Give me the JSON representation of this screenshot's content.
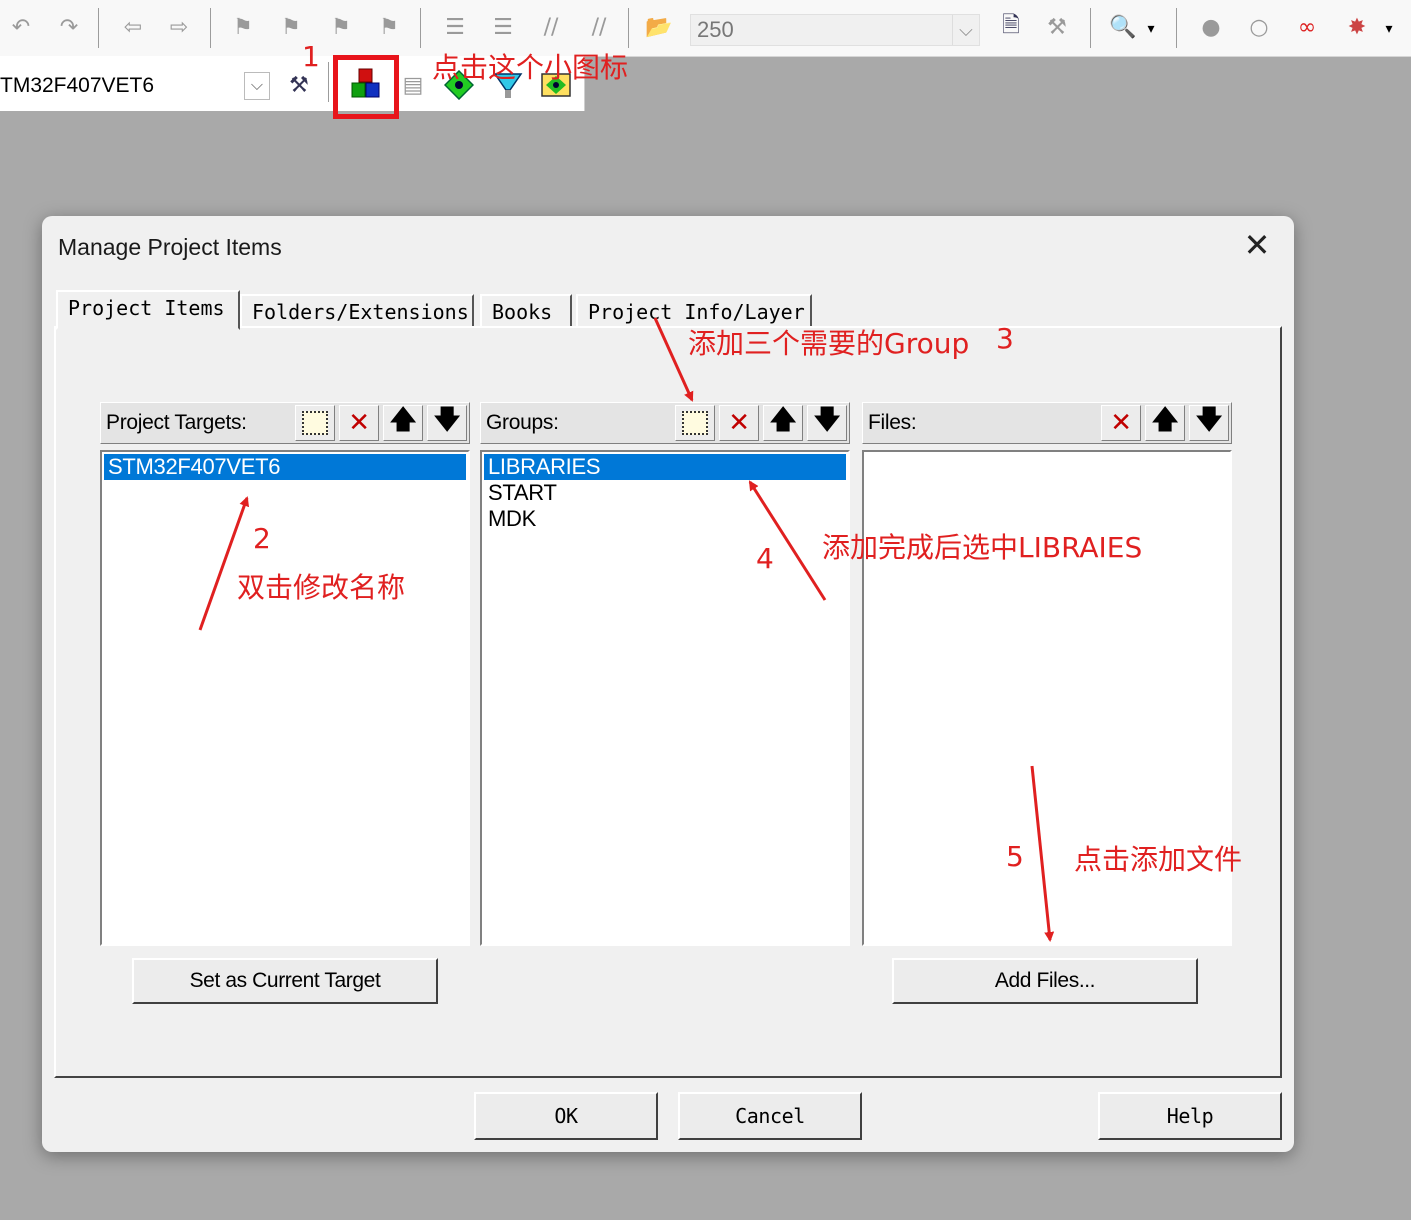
{
  "toolbar": {
    "zoom_value": "250",
    "target_name": "TM32F407VET6"
  },
  "dialog": {
    "title": "Manage Project Items",
    "close": "✕",
    "tabs": [
      "Project Items",
      "Folders/Extensions",
      "Books",
      "Project Info/Layer"
    ],
    "targets": {
      "header": "Project Targets:",
      "items": [
        "STM32F407VET6"
      ],
      "button": "Set as Current Target"
    },
    "groups": {
      "header": "Groups:",
      "items": [
        "LIBRARIES",
        "START",
        "MDK"
      ]
    },
    "files": {
      "header": "Files:",
      "items": [],
      "button": "Add Files..."
    },
    "ok": "OK",
    "cancel": "Cancel",
    "help": "Help"
  },
  "annotations": {
    "n1": "1",
    "t1": "点击这个小图标",
    "n2": "2",
    "t2": "双击修改名称",
    "t3": "添加三个需要的Group",
    "n3": "3",
    "n4": "4",
    "t4": "添加完成后选中LIBRAIES",
    "n5": "5",
    "t5": "点击添加文件"
  },
  "colors": {
    "annotation": "#e02020",
    "selection": "#0078d7"
  }
}
